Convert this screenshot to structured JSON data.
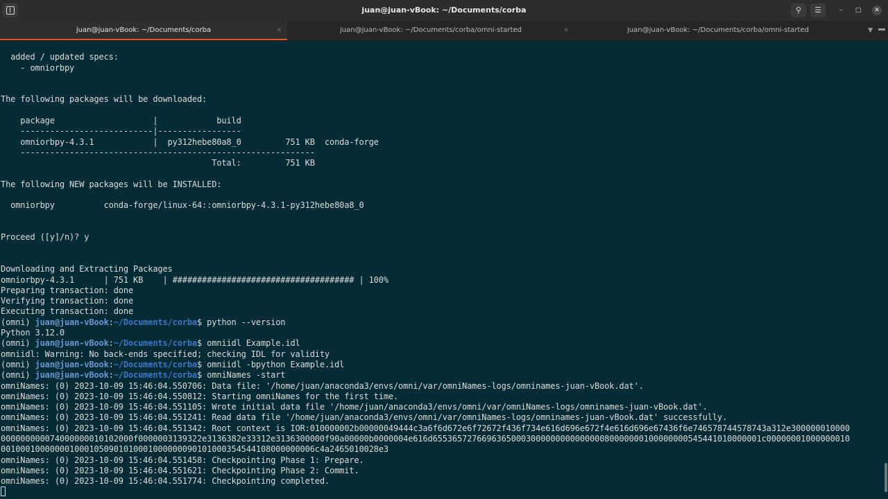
{
  "window": {
    "title": "juan@juan-vBook: ~/Documents/corba"
  },
  "titlebar_icons": {
    "new_tab": "new-tab-icon",
    "search": "search-icon",
    "menu": "hamburger-menu-icon",
    "minimize": "minimize-icon",
    "maximize": "maximize-icon",
    "close": "close-icon"
  },
  "tabs": [
    {
      "label": "juan@juan-vBook: ~/Documents/corba",
      "active": true
    },
    {
      "label": "juan@juan-vBook: ~/Documents/corba/omni-started",
      "active": false
    },
    {
      "label": "juan@juan-vBook: ~/Documents/corba/omni-started",
      "active": false
    }
  ],
  "colors": {
    "terminal_bg": "#052b34",
    "text": "#dcdcdc",
    "prompt_user": "#6b97d3",
    "prompt_path": "#3f74c9",
    "active_tab_accent": "#e95420"
  },
  "prompt": {
    "env": "(omni) ",
    "user_host": "juan@juan-vBook",
    "sep": ":",
    "path": "~/Documents/corba",
    "dollar": "$ "
  },
  "terminal": {
    "lines": [
      "",
      "  added / updated specs:",
      "    - omniorbpy",
      "",
      "",
      "The following packages will be downloaded:",
      "",
      "    package                    |            build",
      "    ---------------------------|-----------------",
      "    omniorbpy-4.3.1            |  py312hebe80a8_0         751 KB  conda-forge",
      "    ------------------------------------------------------------",
      "                                           Total:         751 KB",
      "",
      "The following NEW packages will be INSTALLED:",
      "",
      "  omniorbpy          conda-forge/linux-64::omniorbpy-4.3.1-py312hebe80a8_0",
      "",
      "",
      "Proceed ([y]/n)? y",
      "",
      "",
      "Downloading and Extracting Packages",
      "omniorbpy-4.3.1      | 751 KB    | ##################################### | 100%",
      "Preparing transaction: done",
      "Verifying transaction: done",
      "Executing transaction: done",
      {
        "cmd": "python --version"
      },
      "Python 3.12.0",
      {
        "cmd": "omniidl Example.idl"
      },
      "omniidl: Warning: No back-ends specified; checking IDL for validity",
      {
        "cmd": "omniidl -bpython Example.idl"
      },
      {
        "cmd": "omniNames -start"
      },
      "omniNames: (0) 2023-10-09 15:46:04.550706: Data file: '/home/juan/anaconda3/envs/omni/var/omniNames-logs/omninames-juan-vBook.dat'.",
      "omniNames: (0) 2023-10-09 15:46:04.550812: Starting omniNames for the first time.",
      "omniNames: (0) 2023-10-09 15:46:04.551105: Wrote initial data file '/home/juan/anaconda3/envs/omni/var/omniNames-logs/omninames-juan-vBook.dat'.",
      "omniNames: (0) 2023-10-09 15:46:04.551241: Read data file '/home/juan/anaconda3/envs/omni/var/omniNames-logs/omninames-juan-vBook.dat' successfully.",
      "omniNames: (0) 2023-10-09 15:46:04.551342: Root context is IOR:010000002b00000049444c3a6f6d672e6f72672f436f734e616d696e672f4e616d696e67436f6e746578744578743a312e300000010000",
      "000000000074000000010102000f0000003139322e3136382e33312e3136300000f90a00000b0000004e616d6553657276696365000300000000000000080000000100000000545441010000001c00000001000000010",
      "0010001000000010001050901010001000000090101000354544108000000006c4a2465010028e3",
      "omniNames: (0) 2023-10-09 15:46:04.551458: Checkpointing Phase 1: Prepare.",
      "omniNames: (0) 2023-10-09 15:46:04.551621: Checkpointing Phase 2: Commit.",
      "omniNames: (0) 2023-10-09 15:46:04.551774: Checkpointing completed."
    ]
  }
}
